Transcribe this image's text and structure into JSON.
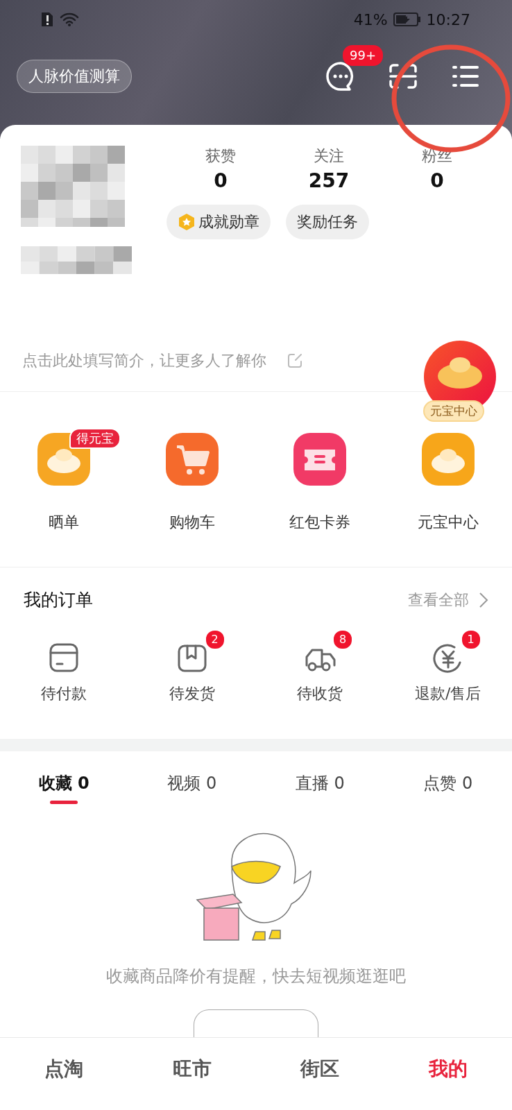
{
  "status_bar": {
    "battery": "41%",
    "time": "10:27"
  },
  "header": {
    "network_value_button": "人脉价值测算",
    "message_badge": "99+"
  },
  "profile": {
    "stats": [
      {
        "label": "获赞",
        "value": "0"
      },
      {
        "label": "关注",
        "value": "257"
      },
      {
        "label": "粉丝",
        "value": "0"
      }
    ],
    "badges": [
      {
        "label": "成就勋章",
        "kind": "medal"
      },
      {
        "label": "奖励任务",
        "kind": "plain"
      }
    ],
    "bio_prompt": "点击此处填写简介，让更多人了解你"
  },
  "floating_coin": {
    "label": "元宝中心"
  },
  "shortcuts": [
    {
      "label": "晒单",
      "tag": "得元宝",
      "kind": "coins"
    },
    {
      "label": "购物车",
      "kind": "cart"
    },
    {
      "label": "红包卡券",
      "kind": "coupon"
    },
    {
      "label": "元宝中心",
      "kind": "ingot"
    }
  ],
  "orders": {
    "title": "我的订单",
    "view_all": "查看全部",
    "items": [
      {
        "label": "待付款",
        "kind": "wallet"
      },
      {
        "label": "待发货",
        "kind": "box",
        "badge": "2"
      },
      {
        "label": "待收货",
        "kind": "truck",
        "badge": "8"
      },
      {
        "label": "退款/售后",
        "kind": "refund",
        "badge": "1"
      }
    ]
  },
  "content_tabs": [
    {
      "label": "收藏 0",
      "selected": true
    },
    {
      "label": "视频 0",
      "selected": false
    },
    {
      "label": "直播 0",
      "selected": false
    },
    {
      "label": "点赞 0",
      "selected": false
    }
  ],
  "empty_state": {
    "message": "收藏商品降价有提醒，快去短视频逛逛吧"
  },
  "bottom_nav": [
    {
      "label": "点淘",
      "selected": false
    },
    {
      "label": "旺市",
      "selected": false
    },
    {
      "label": "街区",
      "selected": false
    },
    {
      "label": "我的",
      "selected": true
    }
  ]
}
